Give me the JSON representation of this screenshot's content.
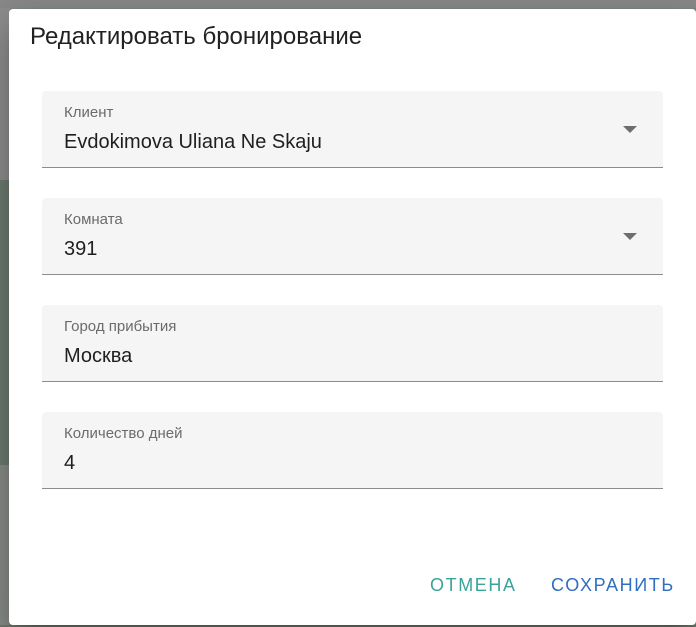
{
  "dialog": {
    "title": "Редактировать бронирование"
  },
  "fields": [
    {
      "label": "Клиент",
      "value": "Evdokimova Uliana Ne Skaju",
      "type": "select"
    },
    {
      "label": "Комната",
      "value": "391",
      "type": "select"
    },
    {
      "label": "Город прибытия",
      "value": "Москва",
      "type": "text"
    },
    {
      "label": "Количество дней",
      "value": "4",
      "type": "number"
    }
  ],
  "actions": {
    "cancel_label": "ОТМЕНА",
    "save_label": "СОХРАНИТЬ"
  },
  "colors": {
    "cancel": "#3aa39a",
    "save": "#2e6fbf",
    "field_bg": "#f5f5f5"
  },
  "icons": {
    "dropdown": "chevron-down-icon"
  }
}
